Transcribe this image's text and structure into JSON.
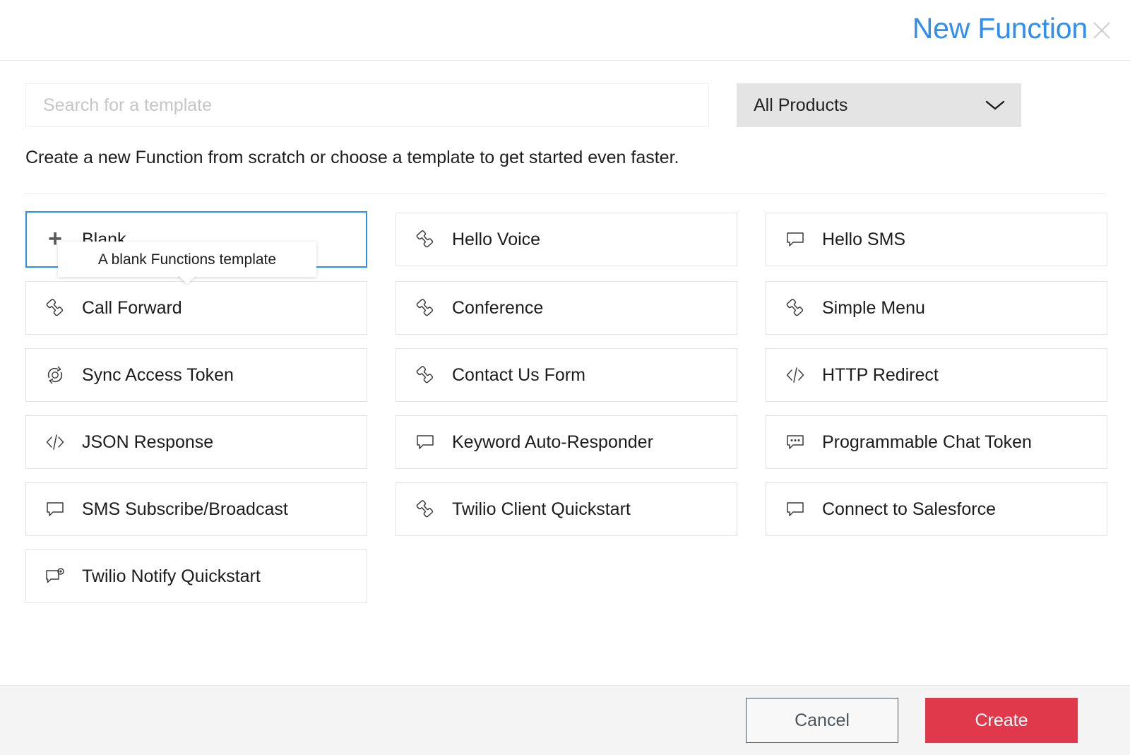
{
  "header": {
    "title": "New Function",
    "close_label": "Close",
    "title_color": "#2f8ef0"
  },
  "search": {
    "placeholder": "Search for a template",
    "value": ""
  },
  "product_filter": {
    "selected": "All Products",
    "icon": "chevron-down-icon"
  },
  "description": "Create a new Function from scratch or choose a template to get started even faster.",
  "tooltip": {
    "text": "A blank Functions template"
  },
  "templates": [
    {
      "label": "Blank",
      "icon": "plus-icon",
      "selected": true
    },
    {
      "label": "Hello Voice",
      "icon": "phone-icon",
      "selected": false
    },
    {
      "label": "Hello SMS",
      "icon": "chat-bubble-icon",
      "selected": false
    },
    {
      "label": "Call Forward",
      "icon": "phone-icon",
      "selected": false
    },
    {
      "label": "Conference",
      "icon": "phone-icon",
      "selected": false
    },
    {
      "label": "Simple Menu",
      "icon": "phone-icon",
      "selected": false
    },
    {
      "label": "Sync Access Token",
      "icon": "sync-icon",
      "selected": false
    },
    {
      "label": "Contact Us Form",
      "icon": "phone-icon",
      "selected": false
    },
    {
      "label": "HTTP Redirect",
      "icon": "code-brackets-icon",
      "selected": false
    },
    {
      "label": "JSON Response",
      "icon": "code-brackets-icon",
      "selected": false
    },
    {
      "label": "Keyword Auto-Responder",
      "icon": "chat-bubble-icon",
      "selected": false
    },
    {
      "label": "Programmable Chat Token",
      "icon": "chat-bubble-dots-icon",
      "selected": false
    },
    {
      "label": "SMS Subscribe/Broadcast",
      "icon": "chat-bubble-icon",
      "selected": false
    },
    {
      "label": "Twilio Client Quickstart",
      "icon": "phone-icon",
      "selected": false
    },
    {
      "label": "Connect to Salesforce",
      "icon": "chat-bubble-icon",
      "selected": false
    },
    {
      "label": "Twilio Notify Quickstart",
      "icon": "chat-bubble-badge-icon",
      "selected": false
    }
  ],
  "footer": {
    "cancel_label": "Cancel",
    "create_label": "Create",
    "create_color": "#e0394b"
  }
}
